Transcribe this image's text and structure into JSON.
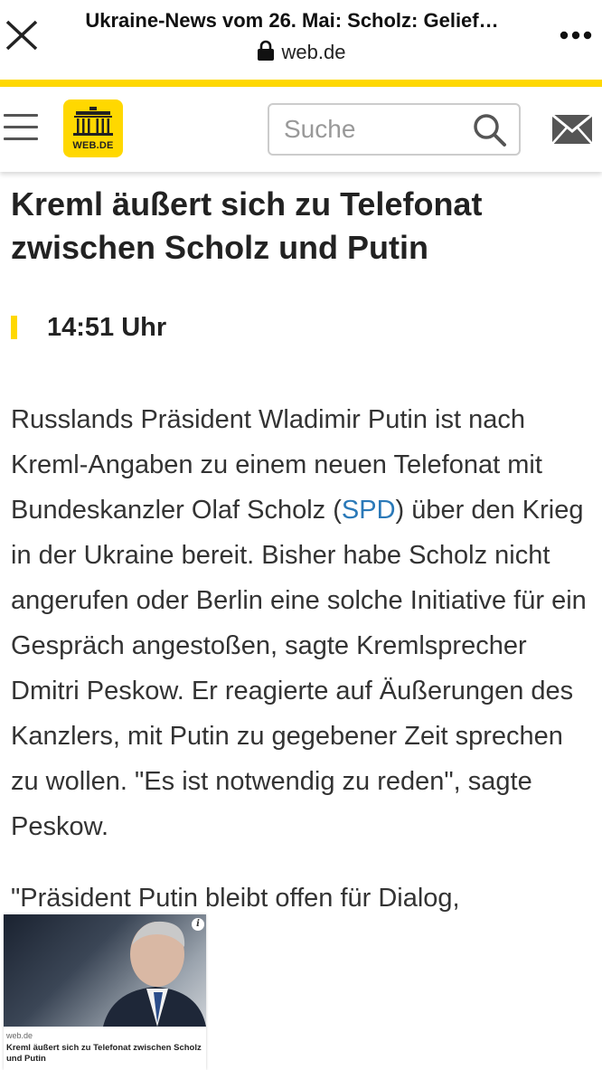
{
  "browser": {
    "page_title": "Ukraine-News vom 26. Mai: Scholz: Gelief…",
    "host": "web.de"
  },
  "header": {
    "logo_text": "WEB.DE",
    "search_placeholder": "Suche"
  },
  "article": {
    "headline": "Kreml äußert sich zu Telefonat zwischen Scholz und Putin",
    "time": "14:51 Uhr",
    "para1_before_link": "Russlands Präsident Wladimir Putin ist nach Kreml-Angaben zu einem neuen Telefonat mit Bundeskanzler Olaf Scholz (",
    "para1_link": "SPD",
    "para1_after_link": ") über den Krieg in der Ukraine bereit. Bisher habe Scholz nicht angerufen oder Berlin eine solche Initiative für ein Gespräch angestoßen, sagte Kremlsprecher Dmitri Peskow. Er reagierte auf Äußerungen des Kanzlers, mit Putin zu gegebener Zeit sprechen zu wollen. \"Es ist notwendig zu reden\", sagte Peskow.",
    "para2": "\"Präsident Putin bleibt offen für Dialog,"
  },
  "pip": {
    "info_glyph": "i",
    "source": "web.de",
    "title": "Kreml äußert sich zu Telefonat zwischen Scholz und Putin"
  },
  "colors": {
    "accent_yellow": "#ffd800",
    "link_blue": "#2a79b8"
  },
  "icons": [
    "close-icon",
    "lock-icon",
    "more-icon",
    "hamburger-icon",
    "search-icon",
    "mail-icon",
    "info-icon"
  ]
}
